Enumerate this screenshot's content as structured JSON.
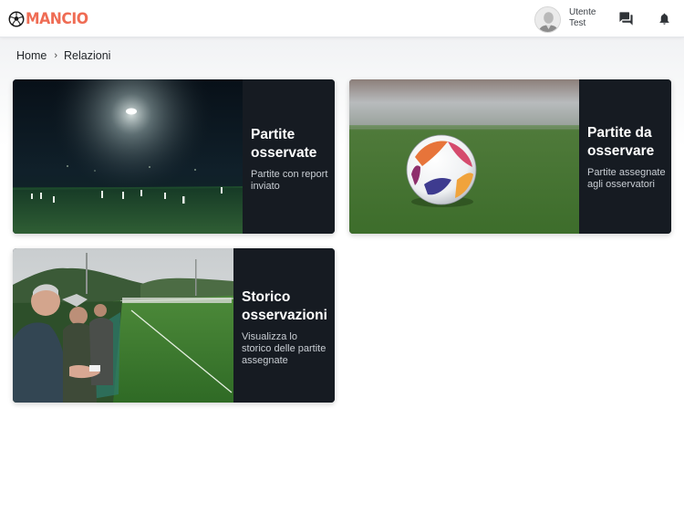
{
  "app": {
    "logo_text": "MANCIO",
    "accent_color": "#ef6c54"
  },
  "header": {
    "user_first": "Utente",
    "user_last": "Test",
    "icons": [
      "user-avatar",
      "chat-icon",
      "bell-icon"
    ]
  },
  "breadcrumb": {
    "home": "Home",
    "separator": "›",
    "current": "Relazioni"
  },
  "cards": [
    {
      "title": "Partite osservate",
      "subtitle": "Partite con report inviato",
      "image": "night-stadium-match"
    },
    {
      "title": "Partite da osservare",
      "subtitle": "Partite assegnate agli osservatori",
      "image": "soccer-ball-on-grass"
    },
    {
      "title": "Storico osservazioni",
      "subtitle": "Visualizza lo storico delle partite assegnate",
      "image": "spectators-at-pitch"
    }
  ]
}
